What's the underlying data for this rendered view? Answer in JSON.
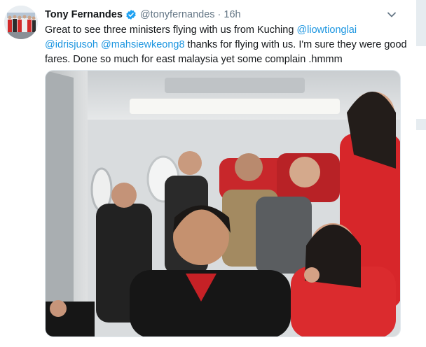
{
  "tweet": {
    "author_name": "Tony Fernandes",
    "handle": "@tonyfernandes",
    "separator": "·",
    "timestamp": "16h",
    "text_parts": [
      {
        "type": "text",
        "value": "Great to see three ministers flying with us from Kuching "
      },
      {
        "type": "mention",
        "value": "@liowtionglai"
      },
      {
        "type": "text",
        "value": " "
      },
      {
        "type": "mention",
        "value": "@idrisjusoh"
      },
      {
        "type": "text",
        "value": " "
      },
      {
        "type": "mention",
        "value": "@mahsiewkeong8"
      },
      {
        "type": "text",
        "value": " thanks for flying with us.  I'm sure they were good fares. Done so much for east malaysia yet some complain .hmmm"
      }
    ],
    "media": {
      "icon": "photo-icon"
    }
  },
  "colors": {
    "link": "#1b95e0",
    "verified": "#1da1f2",
    "secondary_text": "#657786",
    "primary_text": "#14171a",
    "rail": "#e6ecf0",
    "uniform_red": "#d7262a"
  },
  "icons": {
    "verified": "verified-badge-icon",
    "caret": "chevron-down-icon"
  }
}
